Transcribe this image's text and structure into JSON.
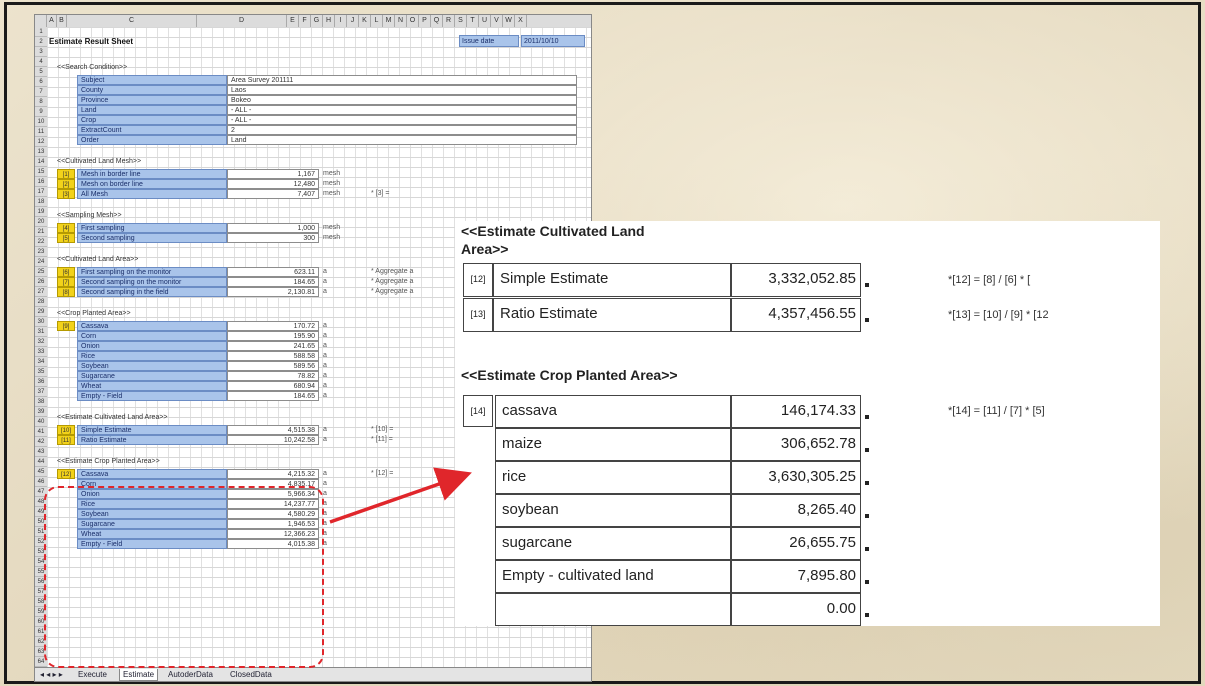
{
  "sheet": {
    "col_headers": [
      "A",
      "B",
      "C",
      "D",
      "E",
      "F",
      "G",
      "H",
      "I",
      "J",
      "K",
      "L",
      "M",
      "N",
      "O",
      "P",
      "Q",
      "R",
      "S",
      "T",
      "U",
      "V",
      "W",
      "X"
    ],
    "title": "Estimate Result Sheet",
    "issue_date_label": "Issue date",
    "issue_date": "2011/10/10",
    "search_condition": {
      "header": "<<Search Condition>>",
      "rows": [
        {
          "label": "Subject",
          "value": "Area Survey 201111"
        },
        {
          "label": "County",
          "value": "Laos"
        },
        {
          "label": "Province",
          "value": "Bokeo"
        },
        {
          "label": "Land",
          "value": "- ALL -"
        },
        {
          "label": "Crop",
          "value": "- ALL -"
        },
        {
          "label": "ExtractCount",
          "value": "2"
        },
        {
          "label": "Order",
          "value": "Land"
        }
      ]
    },
    "cultivated_mesh": {
      "header": "<<Cultivated Land Mesh>>",
      "rows": [
        {
          "idx": "[1]",
          "label": "Mesh in border line",
          "value": "1,167",
          "unit": "mesh"
        },
        {
          "idx": "[2]",
          "label": "Mesh on border line",
          "value": "12,480",
          "unit": "mesh"
        },
        {
          "idx": "[3]",
          "label": "All Mesh",
          "value": "7,407",
          "unit": "mesh",
          "note": "* [3] ="
        }
      ]
    },
    "sampling_mesh": {
      "header": "<<Sampling Mesh>>",
      "rows": [
        {
          "idx": "[4]",
          "label": "First sampling",
          "value": "1,000",
          "unit": "mesh"
        },
        {
          "idx": "[5]",
          "label": "Second sampling",
          "value": "300",
          "unit": "mesh"
        }
      ]
    },
    "cultivated_area": {
      "header": "<<Cultivated Land Area>>",
      "rows": [
        {
          "idx": "[6]",
          "label": "First sampling on the monitor",
          "value": "623.11",
          "unit": "a",
          "note": "* Aggregate a"
        },
        {
          "idx": "[7]",
          "label": "Second sampling on the monitor",
          "value": "184.65",
          "unit": "a",
          "note": "* Aggregate a"
        },
        {
          "idx": "[8]",
          "label": "Second sampling in the field",
          "value": "2,130.81",
          "unit": "a",
          "note": "* Aggregate a"
        }
      ]
    },
    "crop_area": {
      "header": "<<Crop Planted Area>>",
      "idx": "[9]",
      "rows": [
        {
          "label": "Cassava",
          "value": "170.72",
          "unit": "a"
        },
        {
          "label": "Corn",
          "value": "195.90",
          "unit": "a"
        },
        {
          "label": "Onion",
          "value": "241.65",
          "unit": "a"
        },
        {
          "label": "Rice",
          "value": "588.58",
          "unit": "a"
        },
        {
          "label": "Soybean",
          "value": "589.56",
          "unit": "a"
        },
        {
          "label": "Sugarcane",
          "value": "78.82",
          "unit": "a"
        },
        {
          "label": "Wheat",
          "value": "680.94",
          "unit": "a"
        },
        {
          "label": "Empty - Field",
          "value": "184.65",
          "unit": "a"
        }
      ]
    },
    "est_cultivated": {
      "header": "<<Estimate Cultivated Land Area>>",
      "rows": [
        {
          "idx": "[10]",
          "label": "Simple Estimate",
          "value": "4,515.38",
          "unit": "a",
          "note": "* [10] ="
        },
        {
          "idx": "[11]",
          "label": "Ratio Estimate",
          "value": "10,242.58",
          "unit": "a",
          "note": "* [11] ="
        }
      ]
    },
    "est_crop": {
      "header": "<<Estimate Crop Planted Area>>",
      "idx": "[12]",
      "note": "* [12] =",
      "rows": [
        {
          "label": "Cassava",
          "value": "4,215.32",
          "unit": "a"
        },
        {
          "label": "Corn",
          "value": "4,835.17",
          "unit": "a"
        },
        {
          "label": "Onion",
          "value": "5,966.34",
          "unit": "a"
        },
        {
          "label": "Rice",
          "value": "14,237.77",
          "unit": "a"
        },
        {
          "label": "Soybean",
          "value": "4,580.29",
          "unit": "a"
        },
        {
          "label": "Sugarcane",
          "value": "1,946.53",
          "unit": "a"
        },
        {
          "label": "Wheat",
          "value": "12,366.23",
          "unit": "a"
        },
        {
          "label": "Empty - Field",
          "value": "4,015.38",
          "unit": "a"
        }
      ]
    },
    "tabs": [
      "Execute",
      "Estimate",
      "AutoderData",
      "ClosedData"
    ]
  },
  "zoom": {
    "est_cultivated_header_line1": "<<Estimate Cultivated Land",
    "est_cultivated_header_line2": "Area>>",
    "cultivated_rows": [
      {
        "idx": "[12]",
        "label": "Simple Estimate",
        "value": "3,332,052.85",
        "unit": "a",
        "formula": "*[12] =   [8] / [6] * [",
        "formula_extra": ""
      },
      {
        "idx": "[13]",
        "label": "Ratio Estimate",
        "value": "4,357,456.55",
        "unit": "a",
        "formula": "*[13] =   [10] / [9] * [12",
        "formula_extra": ""
      }
    ],
    "est_crop_header": "<<Estimate Crop Planted Area>>",
    "crop_idx": "[14]",
    "crop_formula": "*[14] =   [11] / [7] * [5]",
    "crop_rows": [
      {
        "label": "cassava",
        "value": "146,174.33",
        "unit": "a"
      },
      {
        "label": "maize",
        "value": "306,652.78",
        "unit": "a"
      },
      {
        "label": "rice",
        "value": "3,630,305.25",
        "unit": "a"
      },
      {
        "label": "soybean",
        "value": "8,265.40",
        "unit": "a"
      },
      {
        "label": "sugarcane",
        "value": "26,655.75",
        "unit": "a"
      },
      {
        "label": "Empty - cultivated land",
        "value": "7,895.80",
        "unit": "a"
      },
      {
        "label": "",
        "value": "0.00",
        "unit": "a"
      }
    ]
  },
  "colors": {
    "highlight_blue": "#a9c4ea",
    "index_yellow": "#f2d21a",
    "arrow_red": "#e0262b"
  }
}
